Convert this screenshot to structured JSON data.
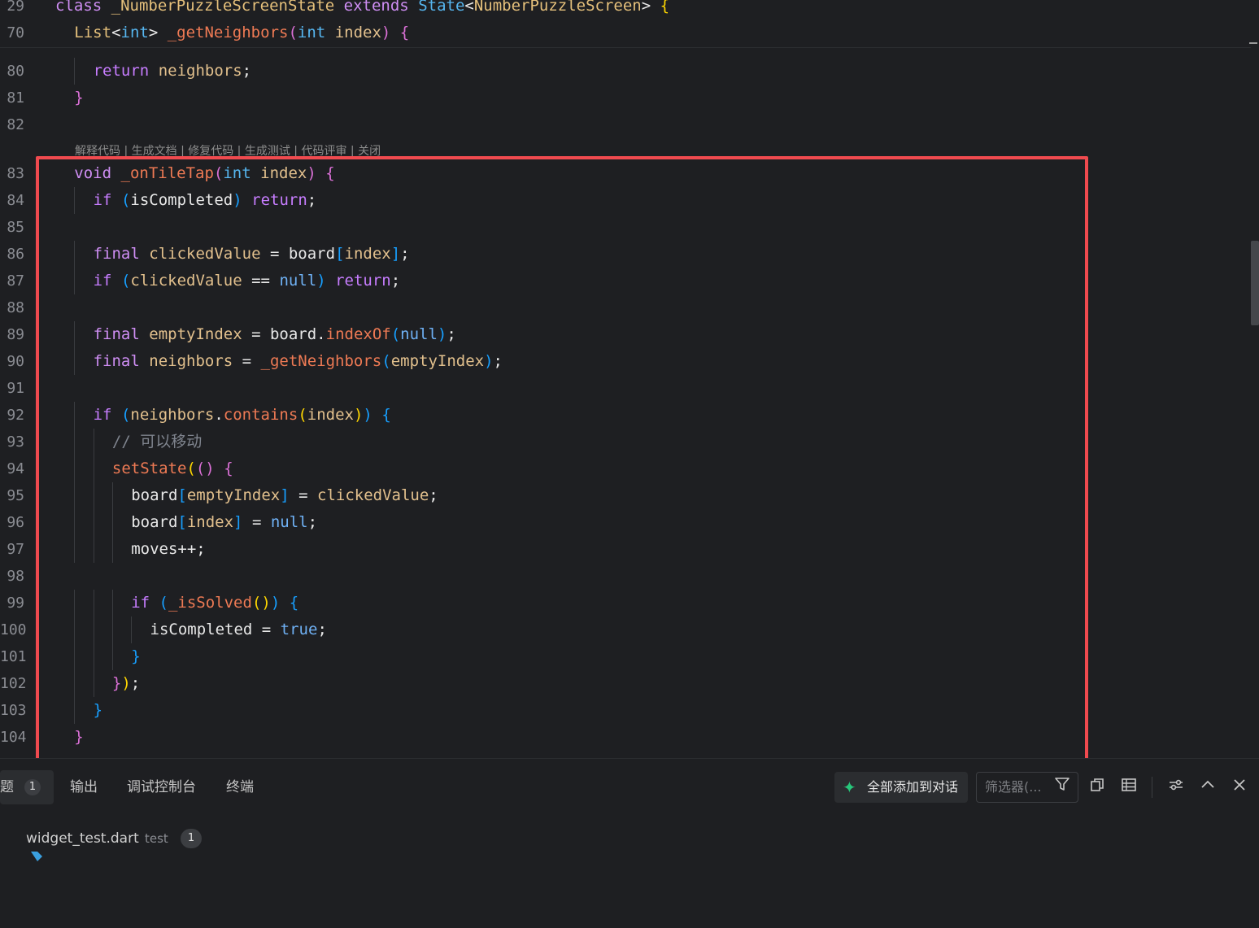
{
  "sticky_lines": [
    {
      "num": "29",
      "indent": 0,
      "tokens": [
        [
          "class",
          "k-kw"
        ],
        [
          " ",
          ""
        ],
        [
          "_NumberPuzzleScreenState",
          "k-cls"
        ],
        [
          " ",
          ""
        ],
        [
          "extends",
          "k-kw"
        ],
        [
          " ",
          ""
        ],
        [
          "State",
          "k-type"
        ],
        [
          "<",
          ""
        ],
        [
          "NumberPuzzleScreen",
          "k-cls"
        ],
        [
          "> ",
          ""
        ],
        [
          "{",
          "b1"
        ]
      ]
    },
    {
      "num": "70",
      "indent": 1,
      "tokens": [
        [
          "List",
          "k-cls"
        ],
        [
          "<",
          ""
        ],
        [
          "int",
          "k-type"
        ],
        [
          "> ",
          ""
        ],
        [
          "_getNeighbors",
          "k-fn"
        ],
        [
          "(",
          "b2"
        ],
        [
          "int",
          "k-type"
        ],
        [
          " ",
          ""
        ],
        [
          "index",
          "k-fld"
        ],
        [
          ")",
          "b2"
        ],
        [
          " ",
          ""
        ],
        [
          "{",
          "b2"
        ]
      ]
    }
  ],
  "lines": [
    {
      "num": "80",
      "indent": 2,
      "tokens": [
        [
          "return",
          "k-ctrl"
        ],
        [
          " ",
          ""
        ],
        [
          "neighbors",
          "k-fld"
        ],
        [
          ";",
          ""
        ]
      ]
    },
    {
      "num": "81",
      "indent": 1,
      "tokens": [
        [
          "}",
          "b2"
        ]
      ]
    },
    {
      "num": "82",
      "indent": 0,
      "tokens": []
    },
    {
      "num": "83",
      "indent": 1,
      "tokens": [
        [
          "void",
          "k-kw"
        ],
        [
          " ",
          ""
        ],
        [
          "_onTileTap",
          "k-fn"
        ],
        [
          "(",
          "b2"
        ],
        [
          "int",
          "k-type"
        ],
        [
          " ",
          ""
        ],
        [
          "index",
          "k-fld"
        ],
        [
          ")",
          "b2"
        ],
        [
          " ",
          ""
        ],
        [
          "{",
          "b2"
        ]
      ]
    },
    {
      "num": "84",
      "indent": 2,
      "tokens": [
        [
          "if",
          "k-ctrl"
        ],
        [
          " ",
          ""
        ],
        [
          "(",
          "b3"
        ],
        [
          "isCompleted",
          "k-var"
        ],
        [
          ")",
          "b3"
        ],
        [
          " ",
          ""
        ],
        [
          "return",
          "k-ctrl"
        ],
        [
          ";",
          ""
        ]
      ]
    },
    {
      "num": "85",
      "indent": 0,
      "tokens": []
    },
    {
      "num": "86",
      "indent": 2,
      "tokens": [
        [
          "final",
          "k-kw"
        ],
        [
          " ",
          ""
        ],
        [
          "clickedValue",
          "k-fld"
        ],
        [
          " = ",
          ""
        ],
        [
          "board",
          "k-var"
        ],
        [
          "[",
          "b3"
        ],
        [
          "index",
          "k-fld"
        ],
        [
          "]",
          "b3"
        ],
        [
          ";",
          ""
        ]
      ]
    },
    {
      "num": "87",
      "indent": 2,
      "tokens": [
        [
          "if",
          "k-ctrl"
        ],
        [
          " ",
          ""
        ],
        [
          "(",
          "b3"
        ],
        [
          "clickedValue",
          "k-fld"
        ],
        [
          " == ",
          ""
        ],
        [
          "null",
          "k-lit"
        ],
        [
          ")",
          "b3"
        ],
        [
          " ",
          ""
        ],
        [
          "return",
          "k-ctrl"
        ],
        [
          ";",
          ""
        ]
      ]
    },
    {
      "num": "88",
      "indent": 0,
      "tokens": []
    },
    {
      "num": "89",
      "indent": 2,
      "tokens": [
        [
          "final",
          "k-kw"
        ],
        [
          " ",
          ""
        ],
        [
          "emptyIndex",
          "k-fld"
        ],
        [
          " = ",
          ""
        ],
        [
          "board",
          "k-var"
        ],
        [
          ".",
          ""
        ],
        [
          "indexOf",
          "k-fn"
        ],
        [
          "(",
          "b3"
        ],
        [
          "null",
          "k-lit"
        ],
        [
          ")",
          "b3"
        ],
        [
          ";",
          ""
        ]
      ]
    },
    {
      "num": "90",
      "indent": 2,
      "tokens": [
        [
          "final",
          "k-kw"
        ],
        [
          " ",
          ""
        ],
        [
          "neighbors",
          "k-fld"
        ],
        [
          " = ",
          ""
        ],
        [
          "_getNeighbors",
          "k-fn"
        ],
        [
          "(",
          "b3"
        ],
        [
          "emptyIndex",
          "k-fld"
        ],
        [
          ")",
          "b3"
        ],
        [
          ";",
          ""
        ]
      ]
    },
    {
      "num": "91",
      "indent": 0,
      "tokens": []
    },
    {
      "num": "92",
      "indent": 2,
      "tokens": [
        [
          "if",
          "k-ctrl"
        ],
        [
          " ",
          ""
        ],
        [
          "(",
          "b3"
        ],
        [
          "neighbors",
          "k-fld"
        ],
        [
          ".",
          ""
        ],
        [
          "contains",
          "k-fn"
        ],
        [
          "(",
          "b1"
        ],
        [
          "index",
          "k-fld"
        ],
        [
          ")",
          "b1"
        ],
        [
          ")",
          "b3"
        ],
        [
          " ",
          ""
        ],
        [
          "{",
          "b3"
        ]
      ]
    },
    {
      "num": "93",
      "indent": 3,
      "tokens": [
        [
          "// 可以移动",
          "k-cm"
        ]
      ]
    },
    {
      "num": "94",
      "indent": 3,
      "tokens": [
        [
          "setState",
          "k-fn"
        ],
        [
          "(",
          "b1"
        ],
        [
          "()",
          "b2"
        ],
        [
          " ",
          ""
        ],
        [
          "{",
          "b2"
        ]
      ]
    },
    {
      "num": "95",
      "indent": 4,
      "tokens": [
        [
          "board",
          "k-var"
        ],
        [
          "[",
          "b3"
        ],
        [
          "emptyIndex",
          "k-fld"
        ],
        [
          "]",
          "b3"
        ],
        [
          " = ",
          ""
        ],
        [
          "clickedValue",
          "k-fld"
        ],
        [
          ";",
          ""
        ]
      ]
    },
    {
      "num": "96",
      "indent": 4,
      "tokens": [
        [
          "board",
          "k-var"
        ],
        [
          "[",
          "b3"
        ],
        [
          "index",
          "k-fld"
        ],
        [
          "]",
          "b3"
        ],
        [
          " = ",
          ""
        ],
        [
          "null",
          "k-lit"
        ],
        [
          ";",
          ""
        ]
      ]
    },
    {
      "num": "97",
      "indent": 4,
      "tokens": [
        [
          "moves++;",
          "k-var"
        ]
      ]
    },
    {
      "num": "98",
      "indent": 0,
      "tokens": []
    },
    {
      "num": "99",
      "indent": 4,
      "tokens": [
        [
          "if",
          "k-ctrl"
        ],
        [
          " ",
          ""
        ],
        [
          "(",
          "b3"
        ],
        [
          "_isSolved",
          "k-fn"
        ],
        [
          "()",
          "b1"
        ],
        [
          ")",
          "b3"
        ],
        [
          " ",
          ""
        ],
        [
          "{",
          "b3"
        ]
      ]
    },
    {
      "num": "100",
      "indent": 5,
      "tokens": [
        [
          "isCompleted",
          "k-var"
        ],
        [
          " = ",
          ""
        ],
        [
          "true",
          "k-lit"
        ],
        [
          ";",
          ""
        ]
      ]
    },
    {
      "num": "101",
      "indent": 4,
      "tokens": [
        [
          "}",
          "b3"
        ]
      ]
    },
    {
      "num": "102",
      "indent": 3,
      "tokens": [
        [
          "}",
          "b2"
        ],
        [
          ")",
          "b1"
        ],
        [
          ";",
          ""
        ]
      ]
    },
    {
      "num": "103",
      "indent": 2,
      "tokens": [
        [
          "}",
          "b3"
        ]
      ]
    },
    {
      "num": "104",
      "indent": 1,
      "tokens": [
        [
          "}",
          "b2"
        ]
      ]
    }
  ],
  "codelens": "解释代码 | 生成文档 | 修复代码 | 生成测试 | 代码评审 | 关闭",
  "panel": {
    "tabs": [
      "问题",
      "输出",
      "调试控制台",
      "终端"
    ],
    "problems_count": "1",
    "add_all_label": "全部添加到对话",
    "filter_placeholder": "筛选器(...",
    "file": {
      "name": "widget_test.dart",
      "folder": "test",
      "count": "1"
    }
  },
  "icons": [
    "sparkle-icon",
    "filter-icon",
    "copy-icon",
    "table-view-icon",
    "settings-sliders-icon",
    "chevron-up-icon",
    "close-icon",
    "dart-file-icon"
  ]
}
